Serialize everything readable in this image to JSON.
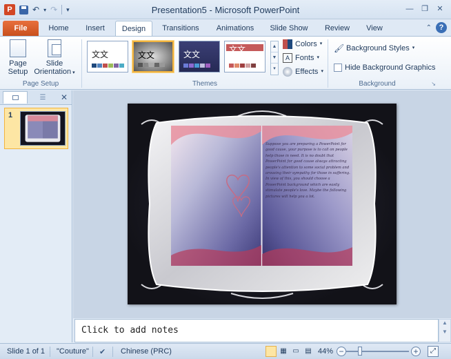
{
  "window": {
    "title": "Presentation5 - Microsoft PowerPoint",
    "app_icon_letter": "P",
    "controls": [
      "minimize",
      "restore",
      "close"
    ]
  },
  "ribbon_tabs": [
    {
      "label": "File"
    },
    {
      "label": "Home"
    },
    {
      "label": "Insert"
    },
    {
      "label": "Design"
    },
    {
      "label": "Transitions"
    },
    {
      "label": "Animations"
    },
    {
      "label": "Slide Show"
    },
    {
      "label": "Review"
    },
    {
      "label": "View"
    }
  ],
  "active_tab": "Design",
  "groups": {
    "page_setup": {
      "label": "Page Setup",
      "page_setup_line1": "Page",
      "page_setup_line2": "Setup",
      "orientation_line1": "Slide",
      "orientation_line2": "Orientation"
    },
    "themes": {
      "label": "Themes",
      "thumb_text": "文文",
      "colors": "Colors",
      "fonts": "Fonts",
      "effects": "Effects"
    },
    "background": {
      "label": "Background",
      "styles": "Background Styles",
      "hide_graphics": "Hide Background Graphics"
    }
  },
  "slides_pane": {
    "slide_number": "1"
  },
  "slide": {
    "body_text": "Suppose you are preparing a PowerPoint for good cause, your purpose is to call on people help those in need. It is no doubt that PowerPoint for good cause always attracting people's attention to some social problem and arousing their sympathy for those in suffering. In view of this, you should choose a PowerPoint background which are easily stimulate people's love. Maybe the following pictures will help you a lot."
  },
  "notes": {
    "placeholder": "Click to add notes"
  },
  "statusbar": {
    "slide_info": "Slide 1 of 1",
    "theme_name": "\"Couture\"",
    "language": "Chinese (PRC)",
    "zoom": "44%"
  },
  "colors": {
    "file_tab": "#d24726",
    "slide_bg": "#121218",
    "selection": "#f2b33d"
  }
}
